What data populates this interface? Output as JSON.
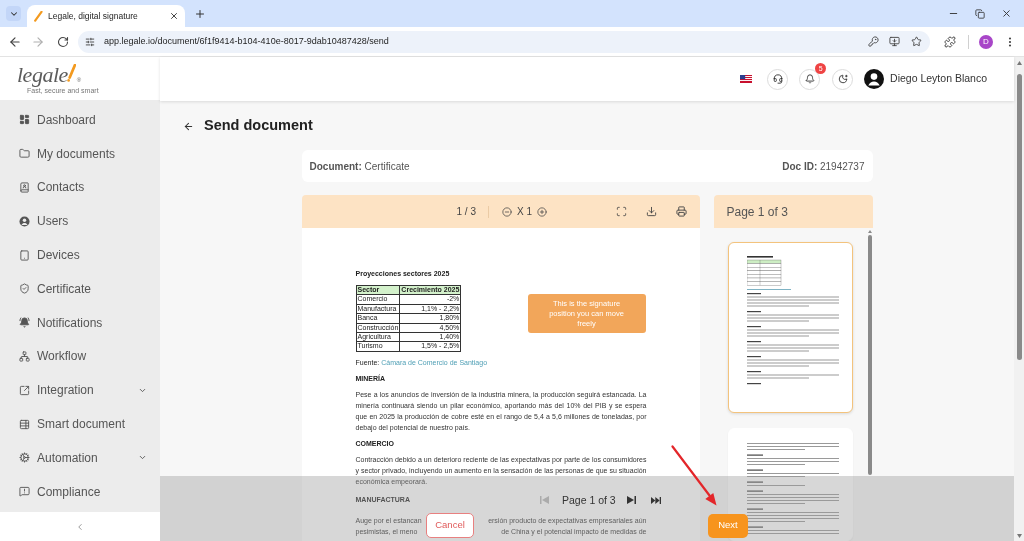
{
  "browser": {
    "tabs": [
      {
        "title": "Legale, digital signature",
        "selected": true
      }
    ],
    "url": "app.legale.io/document/6f1f9414-b104-410e-8017-9dab10487428/send",
    "profile_initial": "D"
  },
  "sidebar": {
    "logo": {
      "wordmark": "legale",
      "registered": "®",
      "tagline": "Fast, secure and smart"
    },
    "items": [
      {
        "label": "Dashboard",
        "expandable": false,
        "selected": false
      },
      {
        "label": "My documents",
        "expandable": false,
        "selected": false
      },
      {
        "label": "Contacts",
        "expandable": false,
        "selected": false
      },
      {
        "label": "Users",
        "expandable": false,
        "selected": false
      },
      {
        "label": "Devices",
        "expandable": false,
        "selected": false
      },
      {
        "label": "Certificate",
        "expandable": false,
        "selected": false
      },
      {
        "label": "Notifications",
        "expandable": false,
        "selected": false
      },
      {
        "label": "Workflow",
        "expandable": false,
        "selected": false
      },
      {
        "label": "Integration",
        "expandable": true,
        "selected": false
      },
      {
        "label": "Smart document",
        "expandable": false,
        "selected": false
      },
      {
        "label": "Automation",
        "expandable": true,
        "selected": false
      },
      {
        "label": "Compliance",
        "expandable": false,
        "selected": false
      }
    ]
  },
  "header": {
    "notification_count": "5",
    "user_name": "Diego Leyton Blanco"
  },
  "page": {
    "title": "Send document",
    "document": "**Document:** Certificate",
    "doc_id": "**Doc ID:** 21942737"
  },
  "viewer": {
    "page_indicator": "1 / 3",
    "zoom": "X 1",
    "signature_box": "This is the signature position you can move freely",
    "document_page": {
      "heading": "Proyecciones sectores 2025",
      "table": {
        "columns": [
          "Sector",
          "Crecimiento 2025"
        ],
        "rows": [
          [
            "Comercio",
            "-2%"
          ],
          [
            "Manufactura",
            "1,1% - 2,2%"
          ],
          [
            "Banca",
            "1,80%"
          ],
          [
            "Construcción",
            "4,50%"
          ],
          [
            "Agricultura",
            "1,40%"
          ],
          [
            "Turismo",
            "1,5% - 2,5%"
          ]
        ]
      },
      "source_label": "Fuente:",
      "source_link": "Cámara de Comercio de Santiago",
      "sections": [
        {
          "kind": "paragraph",
          "title": "MINERÍA",
          "text": "Pese a los anuncios de inversión de la industria minera, la producción seguirá estancada. La minería continuará siendo un pilar económico, aportando más del 10% del PIB y se espera que en 2025 la producción de cobre esté en el rango de 5,4 a 5,6 millones de toneladas, por debajo del potencial de nuestro país."
        },
        {
          "kind": "paragraph",
          "title": "COMERCIO",
          "text": "Contracción debido a un deterioro reciente de las expectativas por parte de los consumidores y sector privado, incluyendo un aumento en la sensación de las personas de que su situación económica empeorará."
        },
        {
          "kind": "covered",
          "title": "MANUFACTURA",
          "lines": [
            [
              "Auge por el estancan",
              "ersión producto de expectativas empresariales aún"
            ],
            [
              "pesimistas, el meno",
              "de China y el potencial impacto de medidas de"
            ]
          ]
        }
      ]
    }
  },
  "thumbnails": {
    "title": "Page 1 of 3",
    "pages": [
      {
        "selected": true
      },
      {
        "selected": false
      }
    ]
  },
  "bottom_bar": {
    "pagination": {
      "label": "Page 1 of 3",
      "controls": [
        {
          "kind": "first",
          "disabled": true
        },
        {
          "kind": "next",
          "disabled": false
        },
        {
          "kind": "last",
          "disabled": false
        }
      ]
    },
    "buttons": [
      {
        "kind": "cancel",
        "label": "Cancel"
      },
      {
        "kind": "next",
        "label": "Next"
      }
    ]
  },
  "annotation_arrow": true
}
